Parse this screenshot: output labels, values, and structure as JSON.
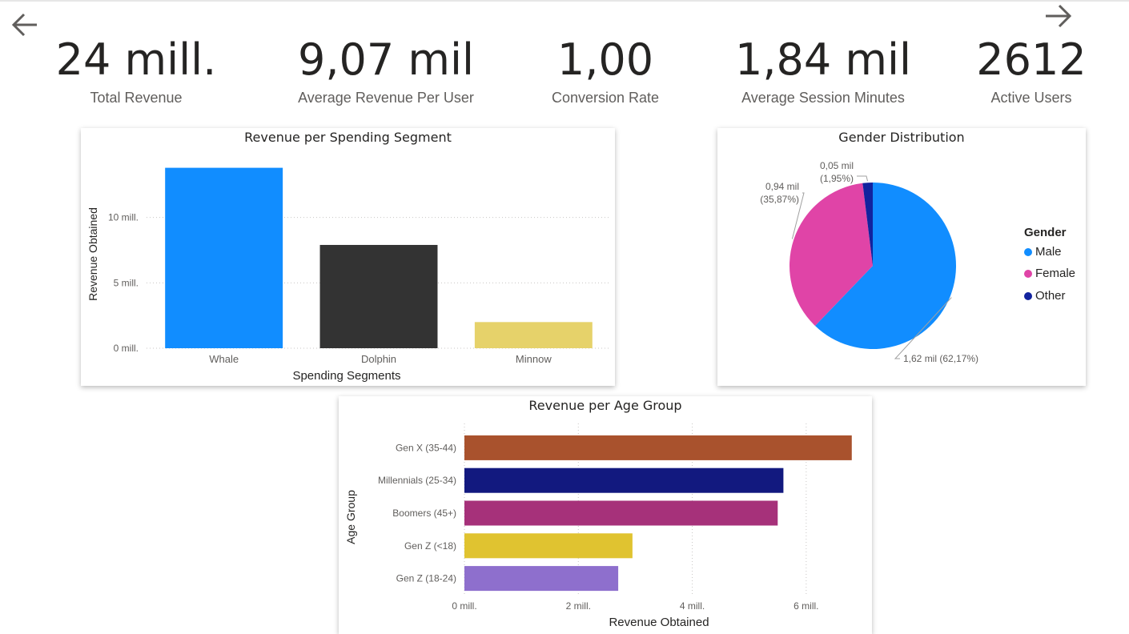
{
  "kpis": [
    {
      "value": "24 mill.",
      "label": "Total Revenue"
    },
    {
      "value": "9,07 mil",
      "label": "Average Revenue Per User"
    },
    {
      "value": "1,00",
      "label": "Conversion Rate"
    },
    {
      "value": "1,84 mil",
      "label": "Average Session Minutes"
    },
    {
      "value": "2612",
      "label": "Active Users"
    }
  ],
  "nav": {
    "back_icon": "arrow-left-icon",
    "forward_icon": "arrow-right-icon"
  },
  "segment_chart": {
    "title": "Revenue per Spending Segment",
    "chart_data": {
      "type": "bar",
      "categories": [
        "Whale",
        "Dolphin",
        "Minnow"
      ],
      "values": [
        13.8,
        7.9,
        2.0
      ],
      "colors": [
        "#118dff",
        "#333333",
        "#e6d26a"
      ],
      "xlabel": "Spending Segments",
      "ylabel": "Revenue Obtained",
      "yticks": [
        "0 mill.",
        "5 mill.",
        "10 mill."
      ],
      "ylim": [
        0,
        15
      ],
      "grid": true
    }
  },
  "gender_chart": {
    "title": "Gender Distribution",
    "legend_title": "Gender",
    "chart_data": {
      "type": "pie",
      "categories": [
        "Male",
        "Female",
        "Other"
      ],
      "values": [
        62.17,
        35.87,
        1.95
      ],
      "colors": [
        "#118dff",
        "#e044a7",
        "#12239e"
      ],
      "labels": [
        [
          "1,62 mil (62,17%)"
        ],
        [
          "0,94 mil",
          "(35,87%)"
        ],
        [
          "0,05 mil",
          "(1,95%)"
        ]
      ],
      "legend_position": "right"
    }
  },
  "age_chart": {
    "title": "Revenue per Age Group",
    "chart_data": {
      "type": "bar",
      "orientation": "horizontal",
      "categories": [
        "Gen X (35-44)",
        "Millennials (25-34)",
        "Boomers (45+)",
        "Gen Z (<18)",
        "Gen Z (18-24)"
      ],
      "values": [
        6.8,
        5.6,
        5.5,
        2.95,
        2.7
      ],
      "colors": [
        "#a9522d",
        "#12197f",
        "#a6317a",
        "#e0c330",
        "#8e6fcd"
      ],
      "xlabel": "Revenue Obtained",
      "ylabel": "Age Group",
      "xticks": [
        "0 mill.",
        "2 mill.",
        "4 mill.",
        "6 mill."
      ],
      "xlim": [
        0,
        7
      ],
      "grid": true
    }
  }
}
